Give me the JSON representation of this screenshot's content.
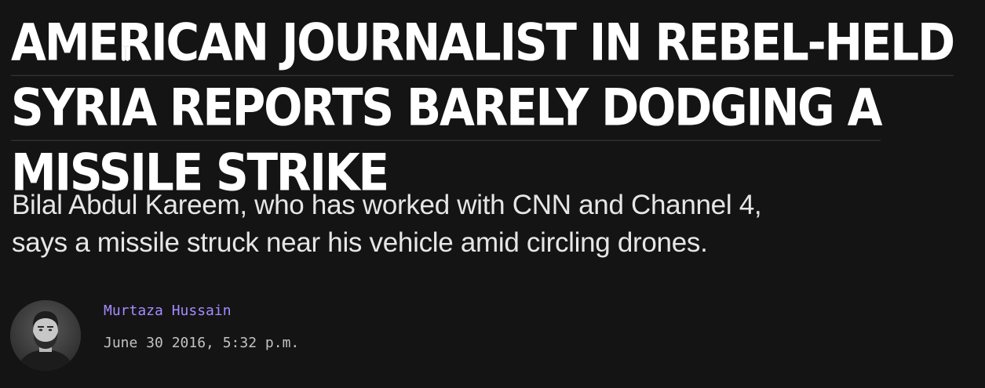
{
  "article": {
    "headline_lines": [
      "AMERICAN JOURNALIST IN REBEL-HELD",
      "SYRIA REPORTS BARELY DODGING A",
      "MISSILE STRIKE"
    ],
    "dek_lines": [
      "Bilal Abdul Kareem, who has worked with CNN and Channel 4,",
      "says a missile struck near his vehicle amid circling drones."
    ],
    "author": "Murtaza Hussain",
    "date": "June 30 2016, 5:32 p.m."
  },
  "colors": {
    "background": "#141414",
    "headline": "#ffffff",
    "author_link": "#a58bff",
    "date": "#c2c2c2"
  },
  "icons": {
    "avatar": "author-photo",
    "cursor": "text-cursor-icon"
  }
}
